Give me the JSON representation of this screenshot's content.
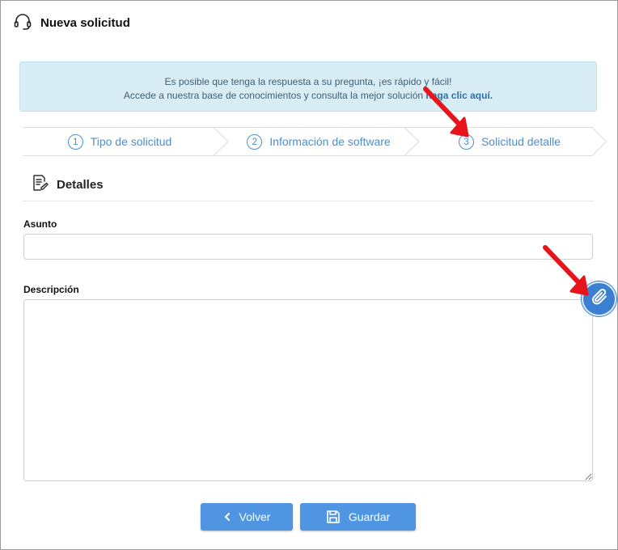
{
  "header": {
    "title": "Nueva solicitud",
    "icon": "headset-icon"
  },
  "banner": {
    "line1": "Es posible que tenga la respuesta a su pregunta, ¡es rápido y fácil!",
    "line2": "Accede a nuestra base de conocimientos y consulta la mejor solución",
    "link": "haga clic aquí."
  },
  "steps": [
    {
      "num": "1",
      "label": "Tipo de solicitud"
    },
    {
      "num": "2",
      "label": "Información de software"
    },
    {
      "num": "3",
      "label": "Solicitud detalle"
    }
  ],
  "section": {
    "title": "Detalles",
    "icon": "edit-document-icon"
  },
  "form": {
    "subject_label": "Asunto",
    "subject_value": "",
    "description_label": "Descripción",
    "description_value": ""
  },
  "buttons": {
    "back": "Volver",
    "save": "Guardar"
  },
  "colors": {
    "accent": "#4f95e1",
    "banner_bg": "#d9edf7",
    "step_text": "#4a8fd0",
    "annotation": "#e8141b"
  }
}
